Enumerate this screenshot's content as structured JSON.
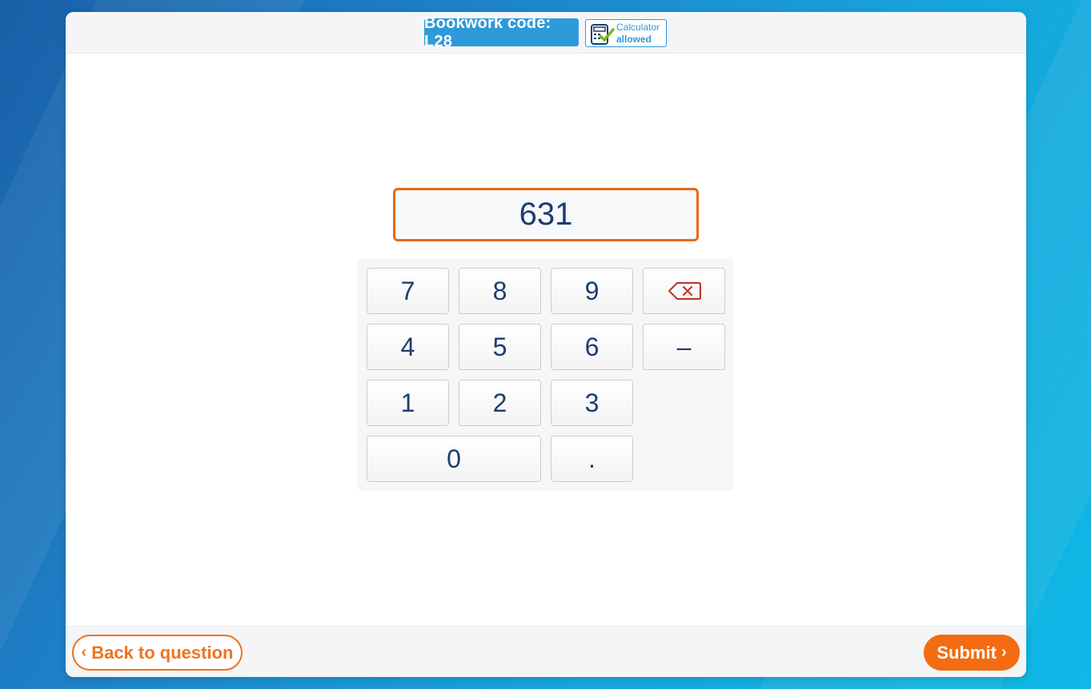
{
  "header": {
    "bookwork_label": "Bookwork code: L28",
    "calculator_line1": "Calculator",
    "calculator_line2": "allowed"
  },
  "answer": {
    "value": "631"
  },
  "keypad": {
    "keys": [
      "7",
      "8",
      "9",
      "4",
      "5",
      "6",
      "–",
      "1",
      "2",
      "3",
      "0",
      "."
    ],
    "backspace_icon": "backspace-icon"
  },
  "footer": {
    "back_label": "Back to question",
    "submit_label": "Submit"
  },
  "colors": {
    "accent_orange": "#f36c12",
    "brand_blue": "#2e9ad9",
    "digit_navy": "#1d3d70",
    "backspace_red": "#c0392b"
  }
}
